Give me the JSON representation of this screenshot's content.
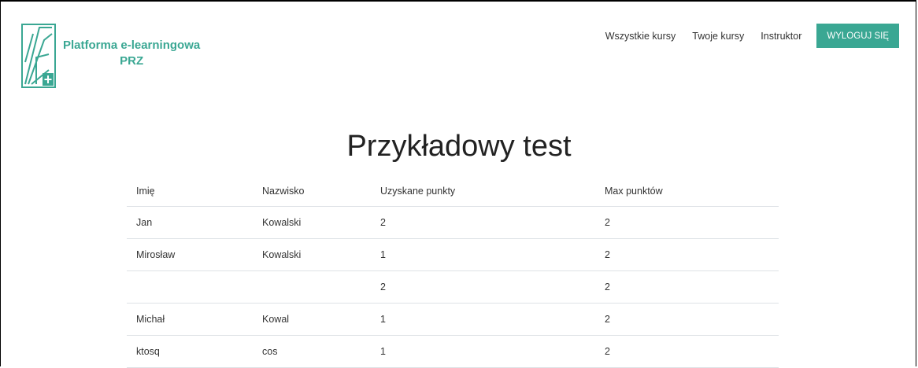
{
  "header": {
    "logo_text_line1": "Platforma e-learningowa",
    "logo_text_line2": "PRZ",
    "nav": {
      "all_courses": "Wszystkie kursy",
      "your_courses": "Twoje kursy",
      "instructor": "Instruktor",
      "logout": "WYLOGUJ SIĘ"
    }
  },
  "main": {
    "title": "Przykładowy test",
    "table": {
      "columns": [
        "Imię",
        "Nazwisko",
        "Uzyskane punkty",
        "Max punktów"
      ],
      "rows": [
        [
          "Jan",
          "Kowalski",
          "2",
          "2"
        ],
        [
          "Mirosław",
          "Kowalski",
          "1",
          "2"
        ],
        [
          "",
          "",
          "2",
          "2"
        ],
        [
          "Michał",
          "Kowal",
          "1",
          "2"
        ],
        [
          "ktosq",
          "cos",
          "1",
          "2"
        ]
      ]
    }
  },
  "colors": {
    "accent": "#3aa793",
    "row_border": "#dee2e6",
    "text": "#333333"
  },
  "icons": {
    "logo": "prz-logo-icon"
  }
}
